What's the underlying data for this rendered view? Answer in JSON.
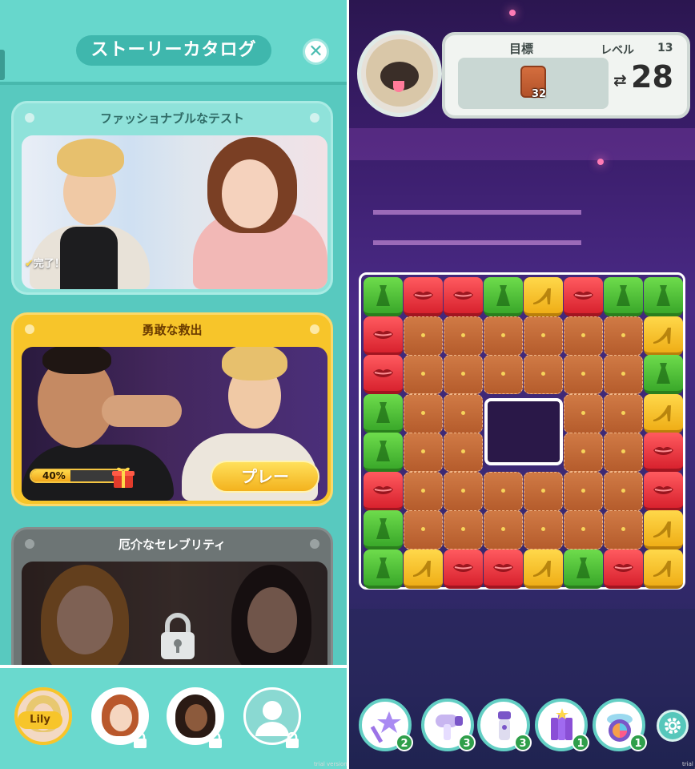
{
  "left": {
    "header": {
      "title": "ストーリーカタログ",
      "close_icon": "close-icon"
    },
    "stories": [
      {
        "title": "ファッショナブルなテスト",
        "status": "完了！"
      },
      {
        "title": "勇敢な救出",
        "progress_text": "40%",
        "progress": 0.4,
        "play_label": "プレー"
      },
      {
        "title": "厄介なセレブリティ",
        "locked": true
      }
    ],
    "characters": [
      {
        "name": "Lily",
        "selected": true,
        "locked": false
      },
      {
        "locked": true
      },
      {
        "locked": true
      },
      {
        "locked": true
      }
    ]
  },
  "right": {
    "goal_label": "目標",
    "level_label": "レベル",
    "level": "13",
    "goal_count": "32",
    "moves_symbol": "⇄",
    "moves_left": "28",
    "boosters": [
      {
        "icon": "magic-wand-icon",
        "count": "2"
      },
      {
        "icon": "hair-dryer-icon",
        "count": "3"
      },
      {
        "icon": "flashlight-icon",
        "count": "3"
      },
      {
        "icon": "firecracker-icon",
        "count": "1"
      },
      {
        "icon": "compact-mirror-icon",
        "count": "1"
      }
    ],
    "board": [
      [
        "green",
        "red",
        "red",
        "green",
        "yellow",
        "red",
        "green",
        "green"
      ],
      [
        "red",
        "bag",
        "bag",
        "bag",
        "bag",
        "bag",
        "bag",
        "yellow"
      ],
      [
        "red",
        "bag",
        "bag",
        "bag",
        "bag",
        "bag",
        "bag",
        "green"
      ],
      [
        "green",
        "bag",
        "bag",
        "hole",
        "hole",
        "bag",
        "bag",
        "yellow"
      ],
      [
        "green",
        "bag",
        "bag",
        "hole",
        "hole",
        "bag",
        "bag",
        "red"
      ],
      [
        "red",
        "bag",
        "bag",
        "bag",
        "bag",
        "bag",
        "bag",
        "red"
      ],
      [
        "green",
        "bag",
        "bag",
        "bag",
        "bag",
        "bag",
        "bag",
        "yellow"
      ],
      [
        "green",
        "yellow",
        "red",
        "red",
        "yellow",
        "green",
        "red",
        "yellow"
      ]
    ],
    "trial_text": "trial version"
  },
  "colors": {
    "teal": "#5fd0c6",
    "gold": "#f7c52a",
    "red_tile": "#e23b44",
    "green_tile": "#4cc236",
    "yellow_tile": "#f6c22c"
  }
}
